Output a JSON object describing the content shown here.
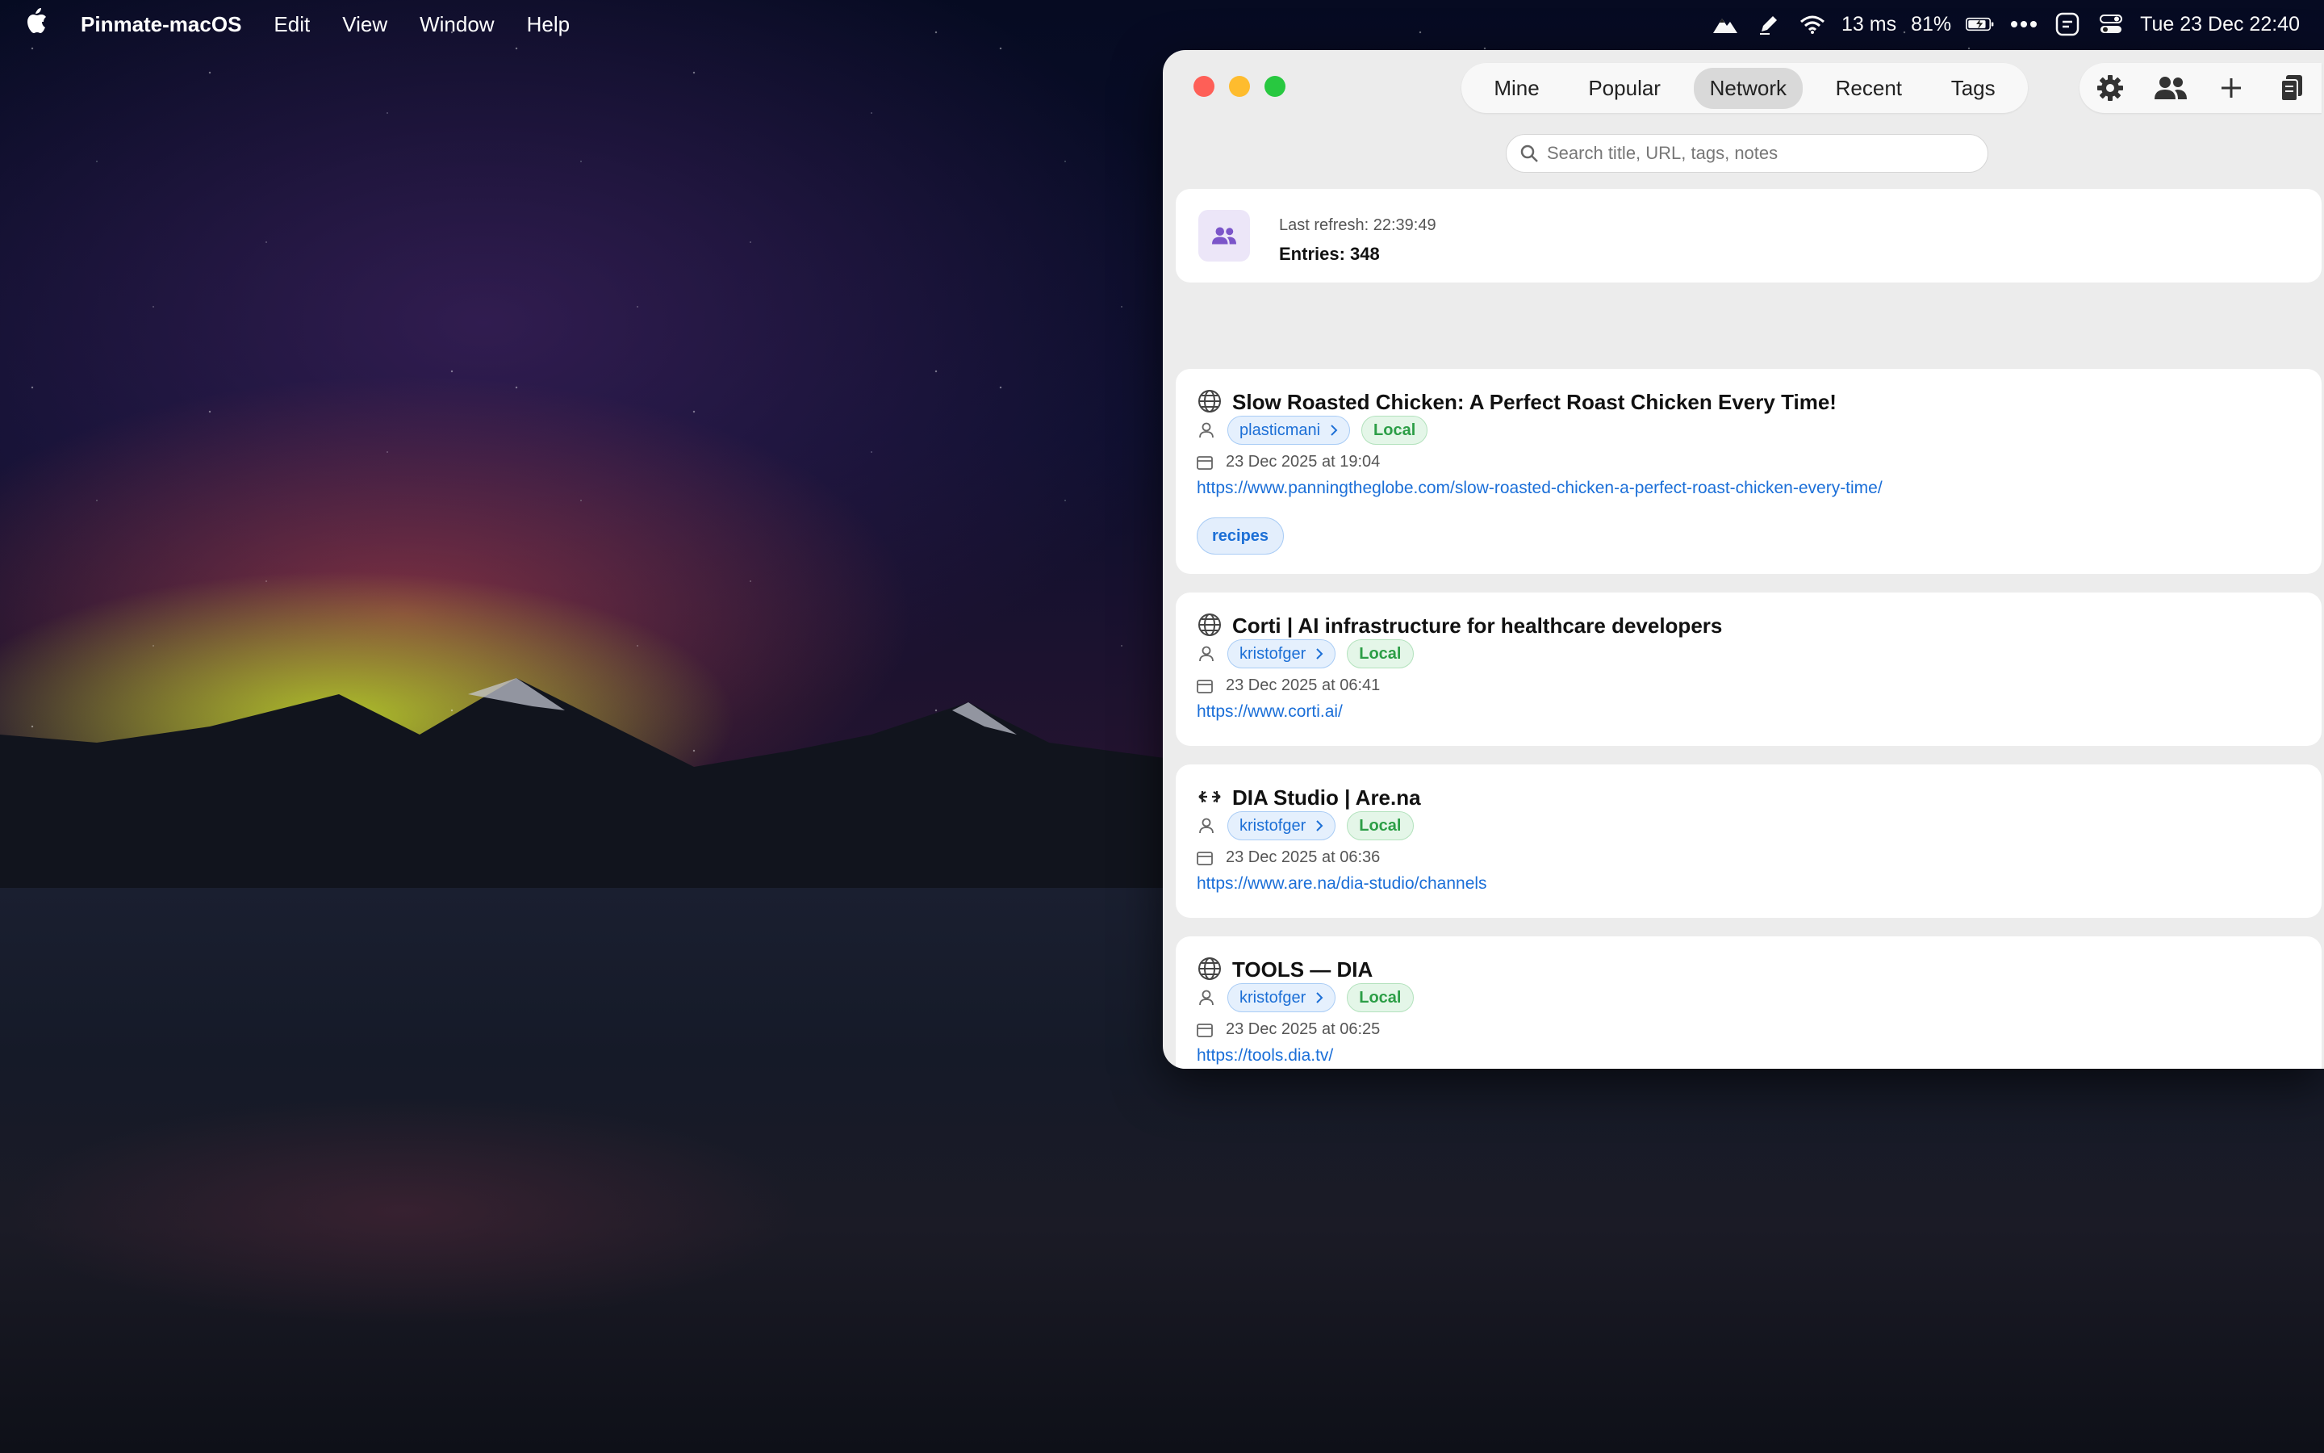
{
  "menubar": {
    "app_name": "Pinmate-macOS",
    "menus": [
      "Edit",
      "View",
      "Window",
      "Help"
    ],
    "ping": "13 ms",
    "battery": "81%",
    "datetime": "Tue 23 Dec  22:40"
  },
  "toolbar": {
    "tabs": [
      "Mine",
      "Popular",
      "Network",
      "Recent",
      "Tags"
    ],
    "active_tab": "Network",
    "icons": [
      "gear-icon",
      "people-icon",
      "plus-icon",
      "clipboard-icon"
    ]
  },
  "search": {
    "placeholder": "Search title, URL, tags, notes",
    "value": ""
  },
  "status": {
    "last_refresh": "Last refresh: 22:39:49",
    "entries": "Entries: 348"
  },
  "entries": [
    {
      "favicon": "globe-icon",
      "title": "Slow Roasted Chicken: A Perfect Roast Chicken Every Time!",
      "user": "plasticmani",
      "source": "Local",
      "date": "23 Dec 2025 at 19:04",
      "url": "https://www.panningtheglobe.com/slow-roasted-chicken-a-perfect-roast-chicken-every-time/",
      "tags": [
        "recipes"
      ]
    },
    {
      "favicon": "globe-icon",
      "title": "Corti | AI infrastructure for healthcare developers",
      "user": "kristofger",
      "source": "Local",
      "date": "23 Dec 2025 at 06:41",
      "url": "https://www.corti.ai/",
      "tags": []
    },
    {
      "favicon": "arena-icon",
      "title": "DIA Studio | Are.na",
      "user": "kristofger",
      "source": "Local",
      "date": "23 Dec 2025 at 06:36",
      "url": "https://www.are.na/dia-studio/channels",
      "tags": []
    },
    {
      "favicon": "globe-icon",
      "title": "TOOLS — DIA",
      "user": "kristofger",
      "source": "Local",
      "date": "23 Dec 2025 at 06:25",
      "url": "https://tools.dia.tv/",
      "tags": []
    }
  ]
}
